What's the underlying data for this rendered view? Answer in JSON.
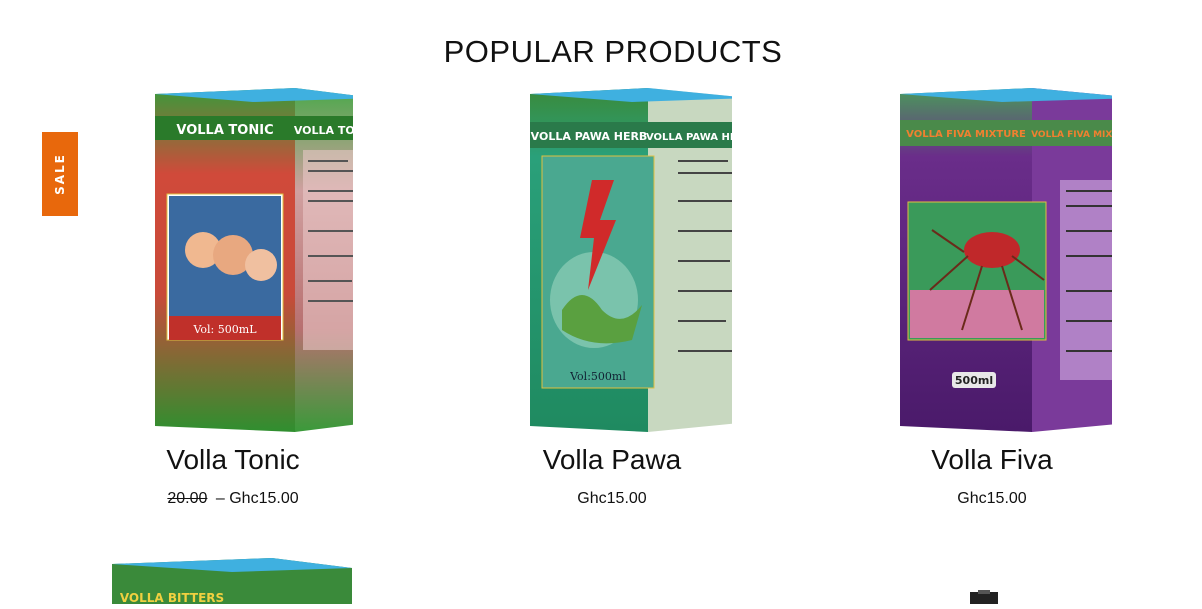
{
  "section": {
    "title": "POPULAR PRODUCTS"
  },
  "badges": {
    "sale": "SALE"
  },
  "products": [
    {
      "name": "Volla Tonic",
      "box_title_front": "VOLLA TONIC",
      "box_title_side": "VOLLA TONIC",
      "volume": "Vol: 500mL",
      "price_old": "20.00",
      "price_sep": "–",
      "price": "Ghc15.00",
      "accent": "#2f8f2f"
    },
    {
      "name": "Volla Pawa",
      "box_title_front": "VOLLA PAWA HERB",
      "box_title_side": "VOLLA PAWA HERB",
      "volume": "Vol:500ml",
      "price": "Ghc15.00",
      "accent": "#1f9a7a"
    },
    {
      "name": "Volla Fiva",
      "box_title_front": "VOLLA FIVA MIXTURE",
      "box_title_side": "VOLLA FIVA MIXTURE",
      "volume": "500ml",
      "price": "Ghc15.00",
      "accent": "#6a2d8a"
    }
  ],
  "next_row": {
    "box_title": "VOLLA BITTERS"
  },
  "colors": {
    "sale_tab": "#e8680c",
    "text": "#111111"
  }
}
